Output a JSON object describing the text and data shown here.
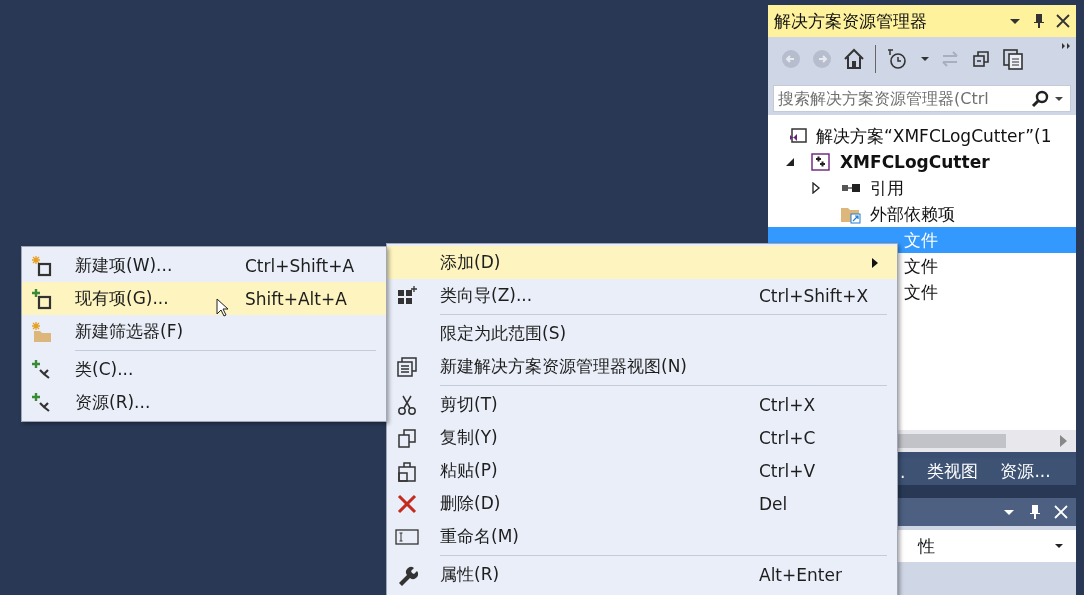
{
  "solution_explorer": {
    "title": "解决方案资源管理器",
    "search": {
      "placeholder": "搜索解决方案资源管理器(Ctrl"
    },
    "tree": [
      {
        "label": "解决方案“XMFCLogCutter”(1",
        "selected": false,
        "children": [
          {
            "label": "XMFCLogCutter",
            "selected": false,
            "expanded": true,
            "children": [
              {
                "label": "引用",
                "selected": false,
                "expanded": false,
                "kind": "full"
              },
              {
                "label": "外部依赖项",
                "selected": false,
                "kind": "full"
              },
              {
                "label": "文件",
                "selected": true,
                "kind": "clipped"
              },
              {
                "label": "文件",
                "selected": false,
                "kind": "clipped"
              },
              {
                "label": "文件",
                "selected": false,
                "kind": "clipped"
              }
            ]
          }
        ]
      }
    ],
    "tabs": [
      {
        "label": ".",
        "selected": false
      },
      {
        "label": "类视图",
        "selected": false
      },
      {
        "label": "资源...",
        "selected": false
      }
    ]
  },
  "properties": {
    "combo": "性"
  },
  "context_menu": {
    "items": [
      {
        "kind": "item",
        "label": "添加(D)",
        "submenu": true,
        "selected": true
      },
      {
        "kind": "item",
        "label": "类向导(Z)...",
        "shortcut": "Ctrl+Shift+X",
        "submenu": false,
        "selected": false
      },
      {
        "kind": "separator"
      },
      {
        "kind": "item",
        "label": "限定为此范围(S)",
        "submenu": false,
        "selected": false
      },
      {
        "kind": "item",
        "label": "新建解决方案资源管理器视图(N)",
        "submenu": false,
        "selected": false
      },
      {
        "kind": "separator"
      },
      {
        "kind": "item",
        "label": "剪切(T)",
        "shortcut": "Ctrl+X",
        "submenu": false,
        "selected": false
      },
      {
        "kind": "item",
        "label": "复制(Y)",
        "shortcut": "Ctrl+C",
        "submenu": false,
        "selected": false
      },
      {
        "kind": "item",
        "label": "粘贴(P)",
        "shortcut": "Ctrl+V",
        "submenu": false,
        "selected": false
      },
      {
        "kind": "item",
        "label": "删除(D)",
        "shortcut": "Del",
        "submenu": false,
        "selected": false
      },
      {
        "kind": "item",
        "label": "重命名(M)",
        "submenu": false,
        "selected": false
      },
      {
        "kind": "separator"
      },
      {
        "kind": "item",
        "label": "属性(R)",
        "shortcut": "Alt+Enter",
        "submenu": false,
        "selected": false
      }
    ]
  },
  "add_submenu": {
    "items": [
      {
        "kind": "item",
        "label": "新建项(W)...",
        "shortcut": "Ctrl+Shift+A",
        "selected": false
      },
      {
        "kind": "item",
        "label": "现有项(G)...",
        "shortcut": "Shift+Alt+A",
        "selected": true
      },
      {
        "kind": "item",
        "label": "新建筛选器(F)",
        "selected": false
      },
      {
        "kind": "separator"
      },
      {
        "kind": "item",
        "label": "类(C)...",
        "selected": false
      },
      {
        "kind": "item",
        "label": "资源(R)...",
        "selected": false
      }
    ]
  }
}
